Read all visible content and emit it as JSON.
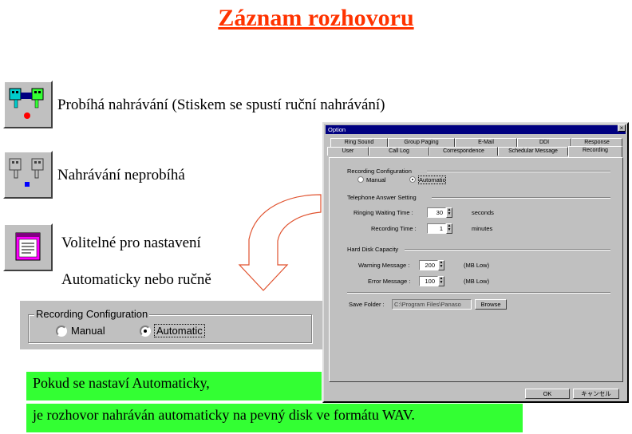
{
  "title": "Záznam rozhovoru",
  "legend": [
    {
      "icon": "recording-active-icon",
      "text": "Probíhá nahrávání (Stiskem se spustí ruční nahrávání)"
    },
    {
      "icon": "recording-inactive-icon",
      "text": "Nahrávání neprobíhá"
    },
    {
      "icon": "settings-dialog-icon",
      "text": "Volitelné pro nastavení"
    }
  ],
  "config_note": "Automaticky nebo ručně",
  "zoom": {
    "group": "Recording Configuration",
    "manual": "Manual",
    "automatic": "Automatic",
    "selected": "Automatic"
  },
  "note_lines": [
    "Pokud se nastaví Automaticky,",
    "je rozhovor nahráván automaticky na pevný disk ve formátu WAV."
  ],
  "dialog": {
    "title": "Option",
    "close": "×",
    "tabs_row1": [
      "Ring Sound",
      "Group Paging",
      "E-Mail",
      "DDI",
      "Response"
    ],
    "tabs_row2": [
      "User",
      "Call Log",
      "Correspondence",
      "Schedular Message",
      "Recording"
    ],
    "active_tab": "Recording",
    "recording_config": {
      "heading": "Recording Configuration",
      "manual": "Manual",
      "automatic": "Automatic"
    },
    "telephone": {
      "heading": "Telephone Answer Setting",
      "ringing_label": "Ringing Waiting Time :",
      "ringing_value": "30",
      "ringing_unit": "seconds",
      "recording_label": "Recording Time :",
      "recording_value": "1",
      "recording_unit": "minutes"
    },
    "disk": {
      "heading": "Hard Disk Capacity",
      "warning_label": "Warning Message :",
      "warning_value": "200",
      "warning_unit": "(MB Low)",
      "error_label": "Error Message :",
      "error_value": "100",
      "error_unit": "(MB Low)"
    },
    "save_folder": {
      "label": "Save Folder :",
      "value": "C:\\Program Files\\Panaso",
      "browse": "Browse"
    },
    "ok": "OK",
    "cancel": "キャンセル"
  }
}
